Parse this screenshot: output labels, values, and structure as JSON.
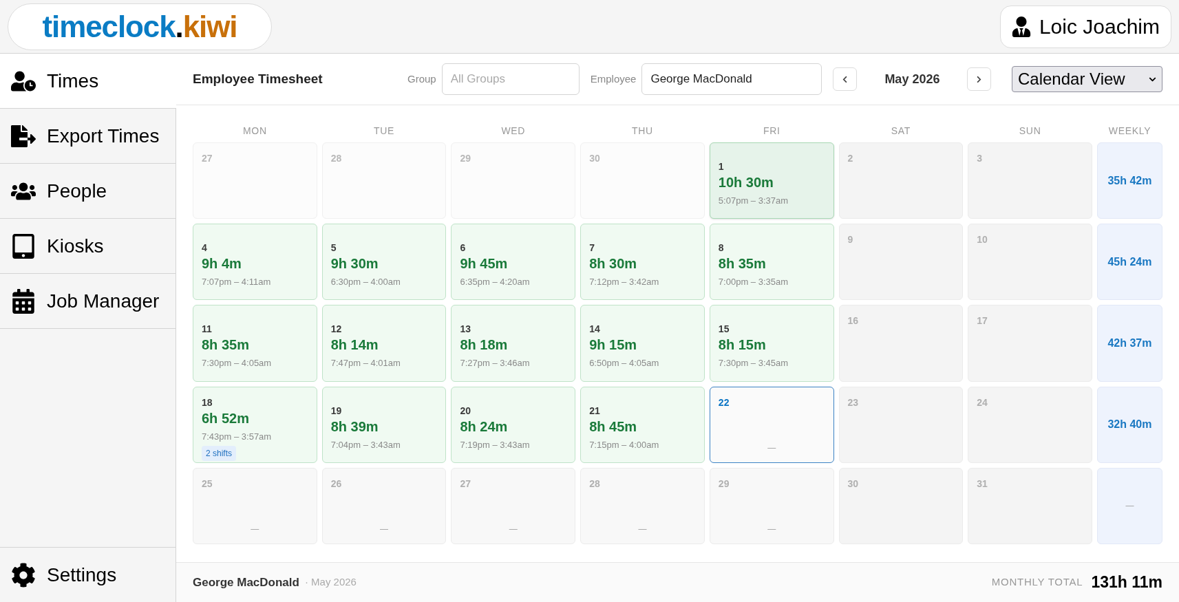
{
  "logo": {
    "name": "timeclock",
    "dot": ".",
    "tld": "kiwi"
  },
  "user": {
    "name": "Loic Joachim"
  },
  "sidebar": {
    "items": [
      {
        "label": "Times",
        "kind": "times",
        "selected": true
      },
      {
        "label": "Export Times",
        "kind": "export",
        "selected": false
      },
      {
        "label": "People",
        "kind": "people",
        "selected": false
      },
      {
        "label": "Kiosks",
        "kind": "kiosk",
        "selected": false
      },
      {
        "label": "Job Manager",
        "kind": "jobs",
        "selected": false
      }
    ],
    "footer_item": {
      "label": "Settings",
      "kind": "settings",
      "selected": false
    }
  },
  "toolbar": {
    "title": "Employee Timesheet",
    "group": {
      "label": "Group",
      "placeholder": "All Groups"
    },
    "employee": {
      "label": "Employee",
      "value": "George MacDonald"
    },
    "month": "May 2026",
    "view": "Calendar View"
  },
  "calendar": {
    "headers": [
      "MON",
      "TUE",
      "WED",
      "THU",
      "FRI",
      "SAT",
      "SUN",
      "WEEKLY"
    ],
    "weeks": [
      {
        "days": [
          {
            "day": "27",
            "kind": "outside",
            "selected": false
          },
          {
            "day": "28",
            "kind": "outside",
            "selected": false
          },
          {
            "day": "29",
            "kind": "outside",
            "selected": false
          },
          {
            "day": "30",
            "kind": "outside",
            "selected": false
          },
          {
            "day": "1",
            "kind": "worked",
            "selected": true,
            "hours": "10h 30m",
            "range": "5:07pm – 3:37am"
          },
          {
            "day": "2",
            "kind": "off",
            "selected": false
          },
          {
            "day": "3",
            "kind": "off",
            "selected": false
          }
        ],
        "weekly": "35h 42m"
      },
      {
        "days": [
          {
            "day": "4",
            "kind": "worked",
            "selected": false,
            "hours": "9h 4m",
            "range": "7:07pm – 4:11am"
          },
          {
            "day": "5",
            "kind": "worked",
            "selected": false,
            "hours": "9h 30m",
            "range": "6:30pm – 4:00am"
          },
          {
            "day": "6",
            "kind": "worked",
            "selected": false,
            "hours": "9h 45m",
            "range": "6:35pm – 4:20am"
          },
          {
            "day": "7",
            "kind": "worked",
            "selected": false,
            "hours": "8h 30m",
            "range": "7:12pm – 3:42am"
          },
          {
            "day": "8",
            "kind": "worked",
            "selected": false,
            "hours": "8h 35m",
            "range": "7:00pm – 3:35am"
          },
          {
            "day": "9",
            "kind": "off",
            "selected": false
          },
          {
            "day": "10",
            "kind": "off",
            "selected": false
          }
        ],
        "weekly": "45h 24m"
      },
      {
        "days": [
          {
            "day": "11",
            "kind": "worked",
            "selected": false,
            "hours": "8h 35m",
            "range": "7:30pm – 4:05am"
          },
          {
            "day": "12",
            "kind": "worked",
            "selected": false,
            "hours": "8h 14m",
            "range": "7:47pm – 4:01am"
          },
          {
            "day": "13",
            "kind": "worked",
            "selected": false,
            "hours": "8h 18m",
            "range": "7:27pm – 3:46am"
          },
          {
            "day": "14",
            "kind": "worked",
            "selected": false,
            "hours": "9h 15m",
            "range": "6:50pm – 4:05am"
          },
          {
            "day": "15",
            "kind": "worked",
            "selected": false,
            "hours": "8h 15m",
            "range": "7:30pm – 3:45am"
          },
          {
            "day": "16",
            "kind": "off",
            "selected": false
          },
          {
            "day": "17",
            "kind": "off",
            "selected": false
          }
        ],
        "weekly": "42h 37m"
      },
      {
        "days": [
          {
            "day": "18",
            "kind": "worked",
            "selected": false,
            "hours": "6h 52m",
            "range": "7:43pm – 3:57am",
            "badge": "2 shifts"
          },
          {
            "day": "19",
            "kind": "worked",
            "selected": false,
            "hours": "8h 39m",
            "range": "7:04pm – 3:43am"
          },
          {
            "day": "20",
            "kind": "worked",
            "selected": false,
            "hours": "8h 24m",
            "range": "7:19pm – 3:43am"
          },
          {
            "day": "21",
            "kind": "worked",
            "selected": false,
            "hours": "8h 45m",
            "range": "7:15pm – 4:00am"
          },
          {
            "day": "22",
            "kind": "today",
            "selected": false,
            "dash": "—"
          },
          {
            "day": "23",
            "kind": "off",
            "selected": false
          },
          {
            "day": "24",
            "kind": "off",
            "selected": false
          }
        ],
        "weekly": "32h 40m"
      },
      {
        "days": [
          {
            "day": "25",
            "kind": "future",
            "selected": false,
            "dash": "—"
          },
          {
            "day": "26",
            "kind": "future",
            "selected": false,
            "dash": "—"
          },
          {
            "day": "27",
            "kind": "future",
            "selected": false,
            "dash": "—"
          },
          {
            "day": "28",
            "kind": "future",
            "selected": false,
            "dash": "—"
          },
          {
            "day": "29",
            "kind": "future",
            "selected": false,
            "dash": "—"
          },
          {
            "day": "30",
            "kind": "off",
            "selected": false
          },
          {
            "day": "31",
            "kind": "off",
            "selected": false
          }
        ],
        "weekly": "—"
      }
    ]
  },
  "footer": {
    "employee": "George MacDonald",
    "period": "· May 2026",
    "total_label": "MONTHLY TOTAL",
    "total": "131h 11m"
  }
}
